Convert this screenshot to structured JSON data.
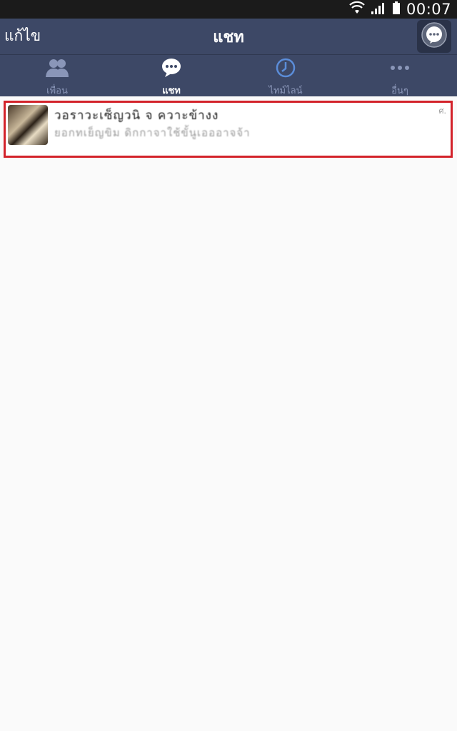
{
  "status_bar": {
    "clock": "00:07"
  },
  "header": {
    "edit_label": "แก้ไข",
    "title": "แชท",
    "chat_button_icon": "chat-bubble-icon"
  },
  "tabs": [
    {
      "label": "เพื่อน",
      "icon": "friends-icon",
      "active": false
    },
    {
      "label": "แชท",
      "icon": "chat-icon",
      "active": true
    },
    {
      "label": "ไทม์ไลน์",
      "icon": "clock-icon",
      "active": false
    },
    {
      "label": "อื่นๆ",
      "icon": "more-icon",
      "active": false
    }
  ],
  "chat_list": [
    {
      "name": "วอราวะเซ็ญวนิ จ ควาะข้างง",
      "preview": "ยอกทเย็ญขิม ดิกกาจาใช้ขั้นูเอออาจจ้า",
      "time": "ศ."
    }
  ],
  "colors": {
    "header_bg": "#3d4866",
    "status_bg": "#1b1b1b",
    "highlight_border": "#d3222a",
    "tab_inactive": "#8a96b8"
  }
}
